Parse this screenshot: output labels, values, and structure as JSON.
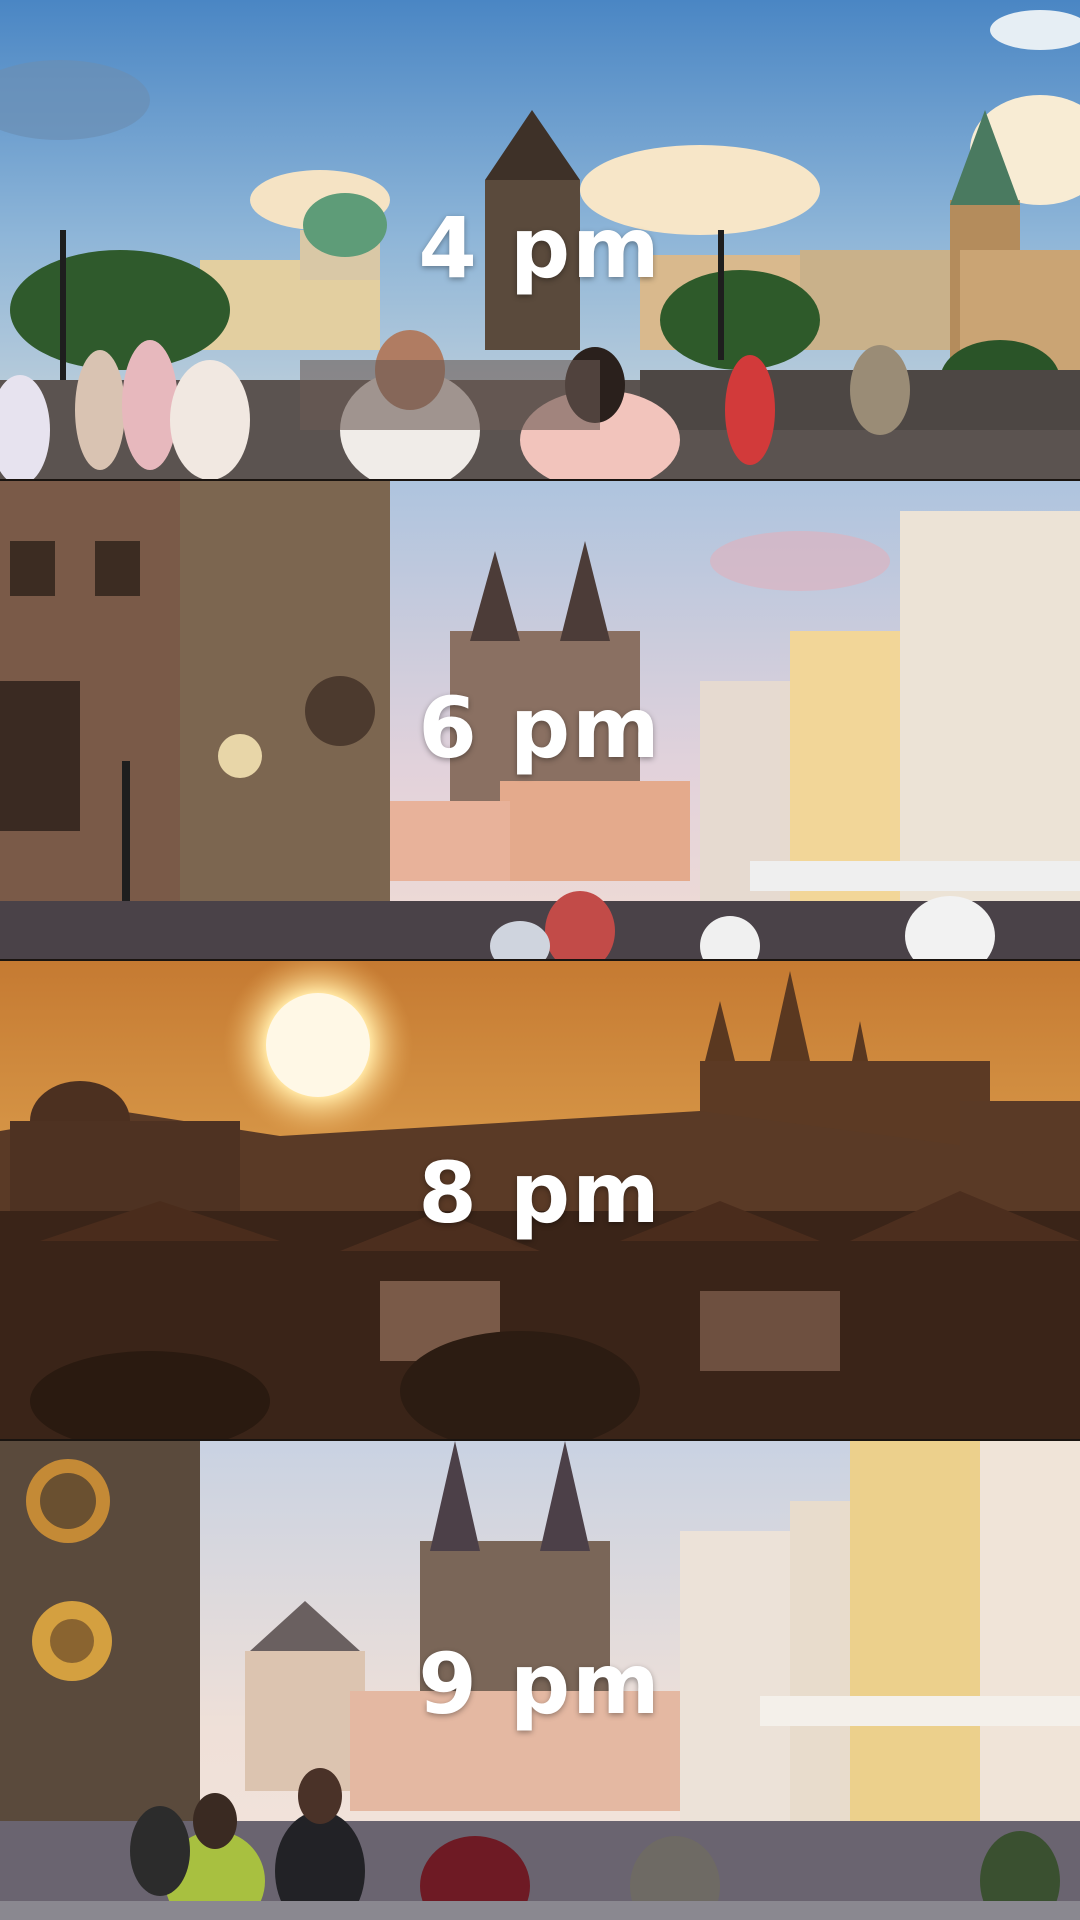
{
  "panels": [
    {
      "label": "4 pm",
      "scene": "Charles Bridge with tourists, tower and domes under blue sky"
    },
    {
      "label": "6 pm",
      "scene": "Old Town Square, astronomical clock and Tyn Church in pink evening light"
    },
    {
      "label": "8 pm",
      "scene": "Sunset over Prague Castle skyline in orange haze"
    },
    {
      "label": "9 pm",
      "scene": "Old Town Square at dusk with crowds"
    }
  ],
  "colors": {
    "sky_day": "#5b93c8",
    "sky_evening": "#d9c7d6",
    "sunset": "#d98b3a",
    "silhouette": "#3a2418",
    "label_text": "#ffffff"
  }
}
